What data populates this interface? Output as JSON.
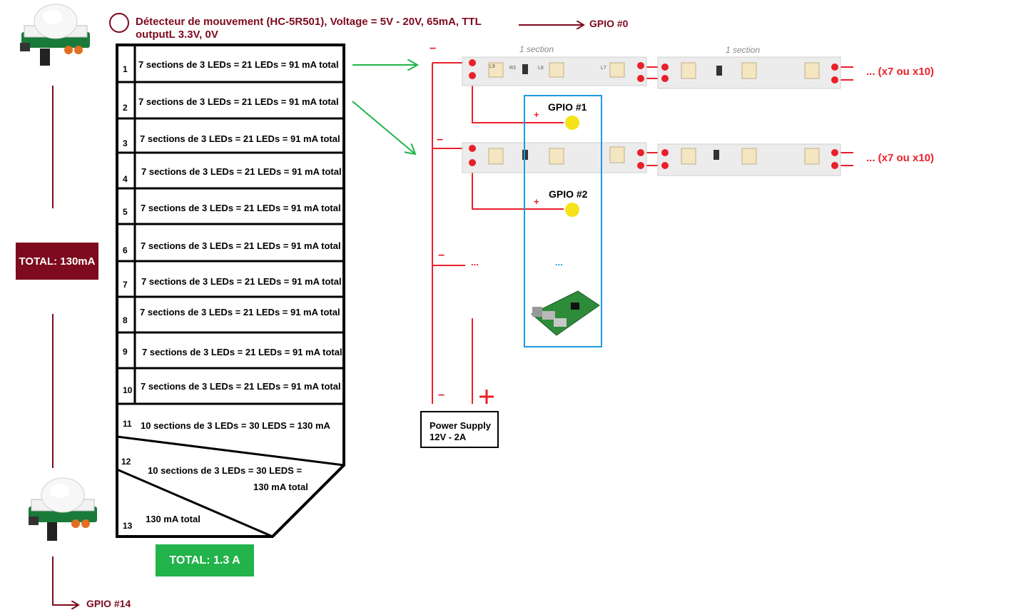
{
  "sensor": {
    "title_line1": "Détecteur de mouvement (HC-5R501), Voltage = 5V - 20V, 65mA, TTL",
    "title_line2": "outputL 3.3V, 0V",
    "gpio_top": "GPIO #0",
    "gpio_bottom": "GPIO #14",
    "total": "TOTAL: 130mA"
  },
  "stairs": [
    {
      "num": "1",
      "label": "7 sections de 3 LEDs = 21 LEDs = 91 mA total"
    },
    {
      "num": "2",
      "label": "7 sections de 3 LEDs = 21 LEDs = 91 mA total"
    },
    {
      "num": "3",
      "label": "7 sections de 3 LEDs = 21 LEDs = 91 mA total"
    },
    {
      "num": "4",
      "label": "7 sections de 3 LEDs = 21 LEDs = 91 mA total"
    },
    {
      "num": "5",
      "label": "7 sections de 3 LEDs = 21 LEDs = 91 mA total"
    },
    {
      "num": "6",
      "label": "7 sections de 3 LEDs = 21 LEDs = 91 mA total"
    },
    {
      "num": "7",
      "label": "7 sections de 3 LEDs = 21 LEDs = 91 mA total"
    },
    {
      "num": "8",
      "label": "7 sections de 3 LEDs = 21 LEDs = 91 mA total"
    },
    {
      "num": "9",
      "label": "7 sections de 3 LEDs = 21 LEDs = 91 mA total"
    },
    {
      "num": "10",
      "label": "7 sections de 3 LEDs = 21 LEDs = 91 mA total"
    },
    {
      "num": "11",
      "label": "10 sections de 3 LEDs = 30 LEDS = 130 mA"
    },
    {
      "num": "12",
      "label_line1": "10 sections de 3 LEDs = 30 LEDS =",
      "label_line2": "130 mA total"
    },
    {
      "num": "13",
      "label": "130 mA total"
    }
  ],
  "stairs_total": "TOTAL: 1.3 A",
  "strips": {
    "section_label": "1 section",
    "repeat_label": "...   (x7 ou x10)",
    "leds": [
      "L9",
      "R3",
      "L8",
      "L7"
    ]
  },
  "gpio": {
    "gpio1": "GPIO #1",
    "gpio2": "GPIO #2",
    "ellipsis": "...",
    "plus": "+",
    "minus": "−"
  },
  "power": {
    "line1": "Power Supply",
    "line2": "12V - 2A",
    "minus": "−",
    "plus": "+"
  },
  "colors": {
    "dark_red": "#7d0a1e",
    "red": "#e8202a",
    "green": "#22b34b",
    "blue": "#1e9be0",
    "gpio_dot": "#f5e31a"
  }
}
